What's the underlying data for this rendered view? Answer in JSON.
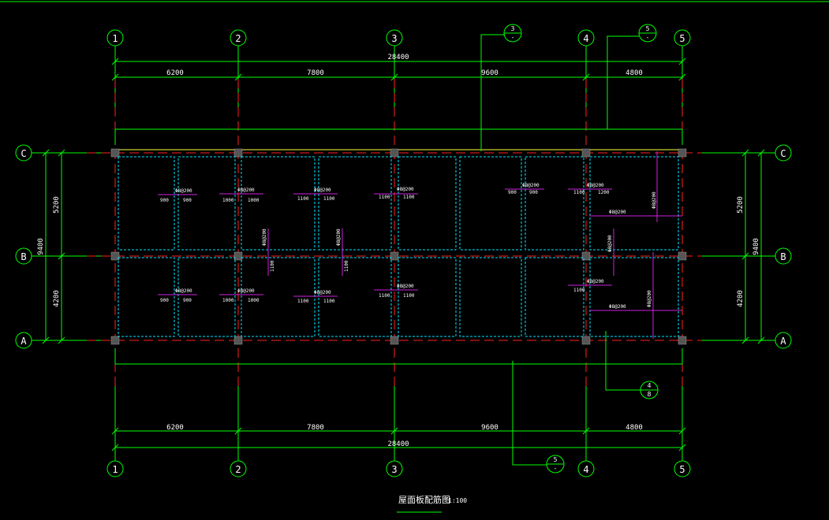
{
  "drawing": {
    "title": "屋面板配筋图",
    "scale": "1:100"
  },
  "axes": {
    "columns": [
      "1",
      "2",
      "3",
      "4",
      "5"
    ],
    "rows": [
      "C",
      "B",
      "A"
    ]
  },
  "dimensions": {
    "total_horizontal": "28400",
    "spans": [
      "6200",
      "7800",
      "9600",
      "4800"
    ],
    "total_vertical": "9400",
    "row_spans": [
      "5200",
      "4200"
    ]
  },
  "section_marks": [
    {
      "number": "3",
      "sheet": "-"
    },
    {
      "number": "5",
      "sheet": "-"
    },
    {
      "number": "4",
      "sheet": "8"
    },
    {
      "number": "5",
      "sheet": "-"
    }
  ],
  "rebar_labels": {
    "top_left": [
      "900",
      "900",
      "1000",
      "1000",
      "1100",
      "1100",
      "1100",
      "1100"
    ],
    "top_right": [
      "900",
      "900",
      "1100",
      "1200"
    ],
    "mid": [
      "1100",
      "1100"
    ],
    "bottom_left": [
      "900",
      "900",
      "1000",
      "1000",
      "1100",
      "1100",
      "1100",
      "1100"
    ],
    "bottom_right": [
      "1100"
    ],
    "spec": "Φ8@200"
  },
  "colors": {
    "grid": "#00ff00",
    "column_dash": "#ff2020",
    "slab_dash": "#00e5ff",
    "rebar": "#d020e0",
    "beam": "#ffff40",
    "text": "#ffffff"
  }
}
